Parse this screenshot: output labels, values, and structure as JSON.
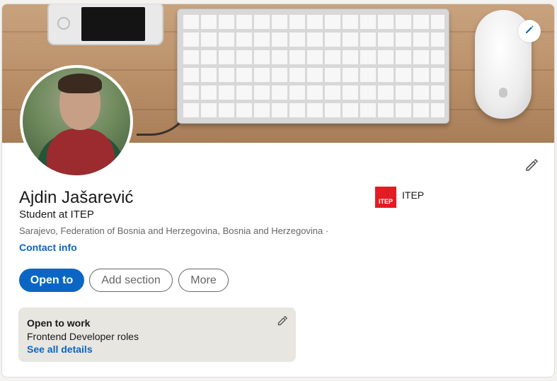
{
  "profile": {
    "name": "Ajdin Jašarević",
    "headline": "Student at ITEP",
    "location": "Sarajevo, Federation of Bosnia and Herzegovina, Bosnia and Herzegovina ·",
    "contact_label": "Contact info"
  },
  "company": {
    "logo_text": "ITEP",
    "name": "ITEP",
    "logo_color": "#e31b23"
  },
  "actions": {
    "open_to": "Open to",
    "add_section": "Add section",
    "more": "More"
  },
  "open_to_work": {
    "title": "Open to work",
    "roles": "Frontend Developer roles",
    "link": "See all details"
  },
  "icons": {
    "banner_edit": "pencil-icon",
    "profile_edit": "pencil-icon",
    "open_to_work_edit": "pencil-icon"
  },
  "colors": {
    "primary": "#0a66c2",
    "card_bg": "#ffffff",
    "page_bg": "#f3f2ef",
    "otw_bg": "#e8e6e1"
  }
}
